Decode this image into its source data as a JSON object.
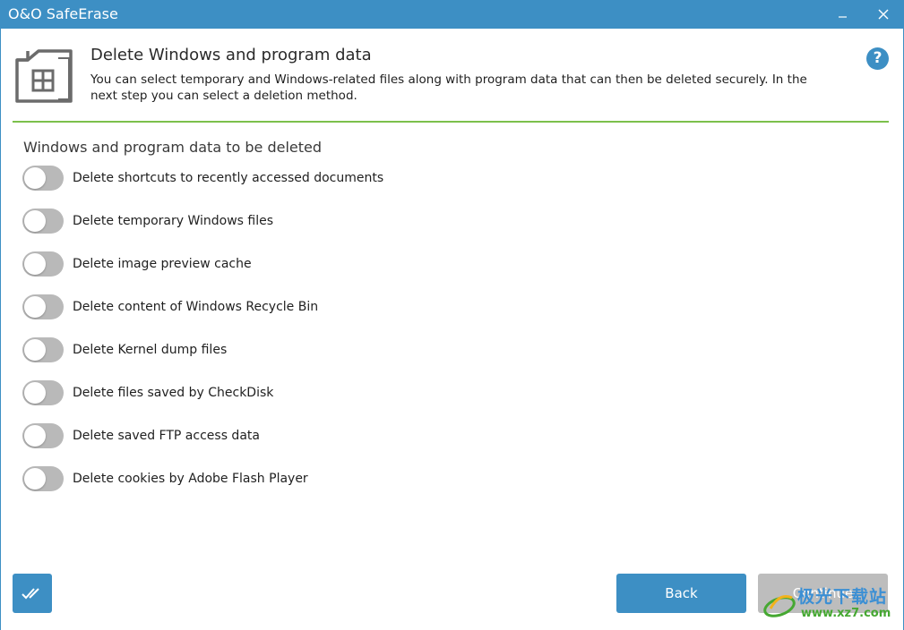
{
  "app": {
    "title": "O&O SafeErase"
  },
  "window_controls": {
    "minimize_icon": "minimize-icon",
    "close_icon": "close-icon"
  },
  "header": {
    "icon": "grid-document-icon",
    "title": "Delete Windows and program data",
    "description": "You can select temporary and Windows-related files along with program data that can then be deleted securely. In the next step you can select a deletion method.",
    "help_label": "?"
  },
  "section": {
    "title": "Windows and program data to be deleted"
  },
  "options": [
    {
      "label": "Delete shortcuts to recently accessed documents",
      "enabled": false
    },
    {
      "label": "Delete temporary Windows files",
      "enabled": false
    },
    {
      "label": "Delete image preview cache",
      "enabled": false
    },
    {
      "label": "Delete content of Windows Recycle Bin",
      "enabled": false
    },
    {
      "label": "Delete Kernel dump files",
      "enabled": false
    },
    {
      "label": "Delete files saved by CheckDisk",
      "enabled": false
    },
    {
      "label": "Delete saved FTP access data",
      "enabled": false
    },
    {
      "label": "Delete cookies by Adobe Flash Player",
      "enabled": false
    }
  ],
  "footer": {
    "check_all_icon": "double-check-icon",
    "back_label": "Back",
    "continue_label": "Continue"
  },
  "watermark": {
    "line1": "极光下载站",
    "line2": "www.xz7.com"
  },
  "colors": {
    "accent": "#3d8fc4",
    "divider": "#7cc04b",
    "toggle_off": "#b9b9b9",
    "disabled_button": "#bdbdbd"
  }
}
